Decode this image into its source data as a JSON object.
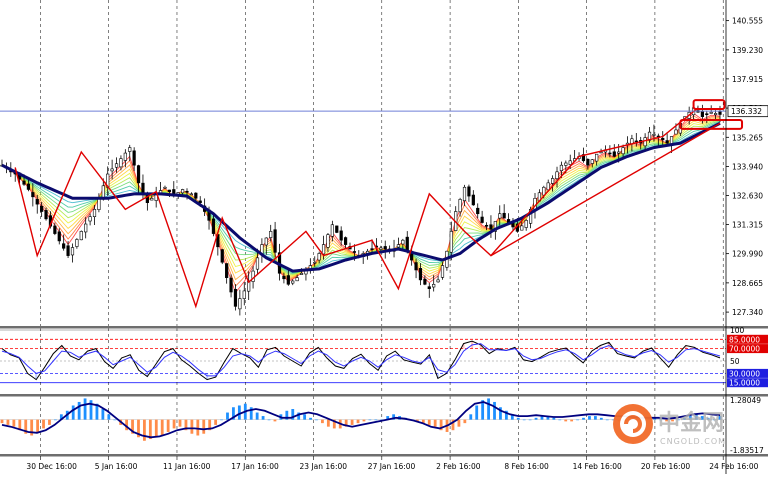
{
  "chart_data": {
    "type": "candlestick",
    "main": {
      "y_ticks": [
        "140.555",
        "139.230",
        "137.915",
        "136.590",
        "135.265",
        "133.940",
        "132.630",
        "131.315",
        "129.990",
        "128.665",
        "127.340"
      ],
      "y_tick_values": [
        140.555,
        139.23,
        137.915,
        136.59,
        135.265,
        133.94,
        132.63,
        131.315,
        129.99,
        128.665,
        127.34
      ],
      "ylim": [
        126.8,
        141.4
      ],
      "current_price_label": "136.332",
      "current_price": 136.332,
      "horizontal_line_value": 136.45,
      "price_path": [
        [
          0,
          134.0
        ],
        [
          3,
          133.6
        ],
        [
          6,
          132.9
        ],
        [
          9,
          131.9
        ],
        [
          12,
          130.9
        ],
        [
          15,
          129.9
        ],
        [
          18,
          131.0
        ],
        [
          21,
          132.0
        ],
        [
          24,
          133.6
        ],
        [
          27,
          134.3
        ],
        [
          29,
          134.8
        ],
        [
          31,
          133.2
        ],
        [
          33,
          132.3
        ],
        [
          35,
          132.7
        ],
        [
          37,
          133.0
        ],
        [
          39,
          132.6
        ],
        [
          41,
          132.9
        ],
        [
          43,
          132.7
        ],
        [
          45,
          132.3
        ],
        [
          47,
          131.5
        ],
        [
          49,
          130.3
        ],
        [
          51,
          128.9
        ],
        [
          53,
          127.6
        ],
        [
          55,
          128.3
        ],
        [
          57,
          129.2
        ],
        [
          59,
          130.4
        ],
        [
          61,
          131.0
        ],
        [
          63,
          129.1
        ],
        [
          65,
          128.6
        ],
        [
          67,
          128.9
        ],
        [
          69,
          129.3
        ],
        [
          71,
          129.6
        ],
        [
          73,
          130.4
        ],
        [
          75,
          131.3
        ],
        [
          77,
          130.6
        ],
        [
          79,
          130.2
        ],
        [
          81,
          129.9
        ],
        [
          83,
          130.1
        ],
        [
          85,
          130.3
        ],
        [
          87,
          130.2
        ],
        [
          89,
          130.2
        ],
        [
          91,
          130.6
        ],
        [
          93,
          129.7
        ],
        [
          95,
          128.8
        ],
        [
          97,
          128.4
        ],
        [
          99,
          128.8
        ],
        [
          101,
          130.1
        ],
        [
          103,
          131.9
        ],
        [
          105,
          133.0
        ],
        [
          107,
          132.2
        ],
        [
          109,
          131.4
        ],
        [
          111,
          131.1
        ],
        [
          113,
          131.8
        ],
        [
          115,
          131.4
        ],
        [
          117,
          131.0
        ],
        [
          119,
          131.5
        ],
        [
          121,
          132.5
        ],
        [
          123,
          133.0
        ],
        [
          125,
          133.4
        ],
        [
          127,
          134.0
        ],
        [
          129,
          134.2
        ],
        [
          131,
          134.4
        ],
        [
          133,
          134.0
        ],
        [
          135,
          134.5
        ],
        [
          137,
          134.7
        ],
        [
          139,
          134.4
        ],
        [
          141,
          134.8
        ],
        [
          143,
          135.2
        ],
        [
          145,
          135.0
        ],
        [
          147,
          135.5
        ],
        [
          149,
          135.3
        ],
        [
          151,
          135.0
        ],
        [
          153,
          135.6
        ],
        [
          155,
          136.2
        ],
        [
          157,
          136.6
        ],
        [
          159,
          136.2
        ],
        [
          161,
          136.4
        ],
        [
          163,
          136.3
        ]
      ],
      "ma_path": [
        [
          0,
          134.0
        ],
        [
          8,
          133.2
        ],
        [
          16,
          132.5
        ],
        [
          24,
          132.5
        ],
        [
          30,
          132.7
        ],
        [
          36,
          132.7
        ],
        [
          42,
          132.6
        ],
        [
          48,
          131.8
        ],
        [
          54,
          130.7
        ],
        [
          60,
          129.8
        ],
        [
          66,
          129.2
        ],
        [
          72,
          129.3
        ],
        [
          78,
          129.7
        ],
        [
          84,
          130.0
        ],
        [
          90,
          130.2
        ],
        [
          96,
          129.9
        ],
        [
          100,
          129.7
        ],
        [
          104,
          130.0
        ],
        [
          108,
          130.6
        ],
        [
          112,
          131.1
        ],
        [
          118,
          131.6
        ],
        [
          124,
          132.3
        ],
        [
          130,
          133.1
        ],
        [
          136,
          133.9
        ],
        [
          142,
          134.4
        ],
        [
          148,
          134.8
        ],
        [
          154,
          135.0
        ],
        [
          158,
          135.4
        ],
        [
          163,
          135.9
        ]
      ],
      "zigzag": [
        [
          3,
          133.9
        ],
        [
          8,
          129.9
        ],
        [
          18,
          134.6
        ],
        [
          28,
          132.0
        ],
        [
          35,
          132.8
        ],
        [
          44,
          127.6
        ],
        [
          50,
          131.6
        ],
        [
          56,
          128.7
        ],
        [
          69,
          131.0
        ],
        [
          73,
          129.9
        ],
        [
          84,
          130.6
        ],
        [
          90,
          128.4
        ],
        [
          97,
          132.7
        ],
        [
          105,
          131.0
        ],
        [
          111,
          129.9
        ],
        [
          131,
          134.4
        ],
        [
          150,
          135.3
        ],
        [
          158,
          136.6
        ]
      ],
      "trendline": [
        [
          111,
          129.9
        ],
        [
          163,
          135.9
        ]
      ],
      "boxes": [
        {
          "x0": 157,
          "x1": 164,
          "y0": 136.55,
          "y1": 136.95
        },
        {
          "x0": 154,
          "x1": 168,
          "y0": 135.65,
          "y1": 136.05
        }
      ]
    },
    "stochastic": {
      "ylim": [
        0,
        100
      ],
      "labels": [
        "100",
        "85.0000",
        "70.0000",
        "50",
        "30.0000",
        "15.0000"
      ],
      "levels": [
        100,
        85,
        70,
        50,
        30,
        15
      ],
      "k_values": [
        70,
        60,
        55,
        30,
        20,
        40,
        62,
        75,
        58,
        52,
        66,
        70,
        49,
        38,
        55,
        60,
        35,
        25,
        45,
        65,
        70,
        52,
        42,
        30,
        20,
        24,
        48,
        70,
        62,
        55,
        40,
        68,
        72,
        58,
        50,
        42,
        63,
        72,
        55,
        42,
        38,
        54,
        61,
        46,
        35,
        58,
        66,
        52,
        48,
        45,
        60,
        22,
        30,
        52,
        78,
        82,
        76,
        62,
        70,
        67,
        72,
        52,
        49,
        56,
        64,
        68,
        71,
        58,
        47,
        66,
        75,
        80,
        62,
        58,
        55,
        66,
        71,
        55,
        40,
        60,
        75,
        72,
        64,
        60,
        55
      ],
      "d_values": [
        66,
        62,
        56,
        42,
        30,
        34,
        50,
        66,
        64,
        56,
        62,
        66,
        56,
        44,
        50,
        56,
        44,
        32,
        40,
        56,
        64,
        58,
        48,
        36,
        26,
        26,
        40,
        58,
        62,
        58,
        48,
        60,
        66,
        62,
        54,
        46,
        58,
        66,
        60,
        48,
        42,
        50,
        56,
        50,
        40,
        52,
        60,
        56,
        50,
        47,
        56,
        36,
        32,
        44,
        66,
        76,
        78,
        68,
        68,
        67,
        70,
        58,
        52,
        54,
        60,
        65,
        68,
        62,
        52,
        60,
        70,
        75,
        66,
        60,
        57,
        63,
        67,
        60,
        48,
        56,
        68,
        70,
        66,
        62,
        58
      ],
      "shading_color": "#ff0000",
      "k_color": "#000000",
      "d_color": "#3333ff"
    },
    "macd": {
      "labels": [
        "1.28049",
        "-1.83517"
      ],
      "ylim": [
        -1.83517,
        1.28049
      ],
      "histogram": [
        -0.2,
        -0.3,
        -0.4,
        -0.6,
        -0.8,
        -0.9,
        -0.7,
        -0.5,
        -0.3,
        0,
        0.3,
        0.5,
        0.8,
        1.0,
        1.2,
        1.1,
        0.9,
        0.6,
        0.3,
        0,
        -0.3,
        -0.6,
        -0.8,
        -1.0,
        -1.2,
        -1.1,
        -1.0,
        -0.9,
        -0.7,
        -0.5,
        -0.4,
        -0.6,
        -0.8,
        -0.9,
        -0.8,
        -0.6,
        -0.3,
        0,
        0.4,
        0.7,
        0.8,
        0.9,
        0.7,
        0.4,
        0.2,
        0,
        -0.1,
        0.3,
        0.5,
        0.6,
        0.4,
        0.3,
        0.1,
        0,
        -0.2,
        -0.4,
        -0.5,
        -0.5,
        -0.4,
        -0.3,
        -0.2,
        -0.1,
        0,
        0,
        0,
        0.2,
        0.3,
        0.2,
        0.1,
        0,
        -0.1,
        -0.2,
        -0.3,
        -0.4,
        -0.6,
        -0.7,
        -0.6,
        -0.4,
        -0.2,
        0.3,
        0.8,
        1.1,
        1.2,
        1.0,
        0.7,
        0.5,
        0.3,
        0.1,
        0,
        0,
        0.1,
        0.2,
        0.2,
        0.1,
        0,
        -0.1,
        -0.1,
        0,
        0.1,
        0.2,
        0.2,
        0.1,
        0,
        0,
        -0.1,
        -0.1,
        0,
        0,
        0.1,
        0.1,
        0.1,
        0,
        -0.1,
        -0.1,
        0,
        0.1,
        0.2,
        0.3,
        0.2,
        0.1,
        0,
        0.2
      ],
      "signal": [
        -0.3,
        -0.4,
        -0.55,
        -0.7,
        -0.75,
        -0.6,
        -0.3,
        0.1,
        0.5,
        0.8,
        0.9,
        0.8,
        0.5,
        0.1,
        -0.3,
        -0.7,
        -0.9,
        -1.0,
        -0.95,
        -0.8,
        -0.6,
        -0.5,
        -0.5,
        -0.55,
        -0.5,
        -0.3,
        0,
        0.3,
        0.5,
        0.6,
        0.5,
        0.3,
        0.1,
        0.1,
        0.3,
        0.4,
        0.3,
        0.1,
        -0.1,
        -0.3,
        -0.4,
        -0.3,
        -0.2,
        -0.1,
        0,
        0.1,
        0.05,
        -0.05,
        -0.2,
        -0.4,
        -0.5,
        -0.3,
        0,
        0.5,
        0.9,
        1.0,
        0.8,
        0.5,
        0.3,
        0.2,
        0.2,
        0.25,
        0.2,
        0.15,
        0.15,
        0.2,
        0.25,
        0.3,
        0.3,
        0.25,
        0.2,
        0.2,
        0.15,
        0.1,
        0.1,
        0.1,
        0.05,
        0.1,
        0.2,
        0.3,
        0.35,
        0.3,
        0.25
      ],
      "hist_pos_color": "#1e90ff",
      "hist_neg_color": "#ff8c4a",
      "signal_color": "#000080"
    },
    "x_ticks": [
      "30 Dec 16:00",
      "5 Jan 16:00",
      "11 Jan 16:00",
      "17 Jan 16:00",
      "23 Jan 16:00",
      "27 Jan 16:00",
      "2 Feb 16:00",
      "8 Feb 16:00",
      "14 Feb 16:00",
      "20 Feb 16:00",
      "24 Feb 16:00"
    ],
    "grid": true,
    "colors": {
      "ma": "#0b0b6e",
      "zigzag": "#e00000",
      "current_line": "#6f7fd6",
      "candle": "#000000"
    }
  },
  "watermark": {
    "title": "中金网",
    "url": "CNGOLD.COM"
  }
}
